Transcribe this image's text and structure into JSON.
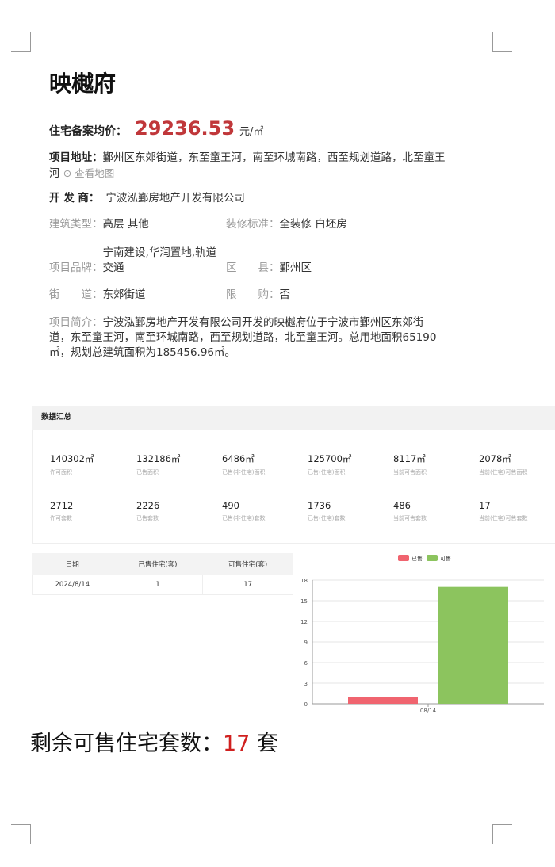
{
  "project": {
    "name": "映樾府",
    "price_label": "住宅备案均价：",
    "price_value": "29236.53",
    "price_unit": "元/㎡",
    "address_label": "项目地址：",
    "address": "鄞州区东郊街道，东至童王河，南至环城南路，西至规划道路，北至童王河",
    "map_link": "⊙ 查看地图",
    "developer_label": "开 发 商：",
    "developer": "宁波泓鄞房地产开发有限公司"
  },
  "info": {
    "building_type_label": "建筑类型：",
    "building_type": "高层 其他",
    "decoration_label": "装修标准：",
    "decoration": "全装修 白坯房",
    "brand_label": "项目品牌：",
    "brand_line1": "宁南建设,华润置地,轨道",
    "brand_line2": "交通",
    "district_label": "区　　县：",
    "district": "鄞州区",
    "street_label": "街　　道：",
    "street": "东郊街道",
    "limit_label": "限　　购：",
    "limit": "否",
    "intro_label": "项目简介：",
    "intro": "宁波泓鄞房地产开发有限公司开发的映樾府位于宁波市鄞州区东郊街道，东至童王河，南至环城南路，西至规划道路，北至童王河。总用地面积65190㎡，规划总建筑面积为185456.96㎡。"
  },
  "summary_panel": {
    "title": "数据汇总",
    "stats": [
      {
        "value": "140302㎡",
        "label": "许可面积"
      },
      {
        "value": "132186㎡",
        "label": "已售面积"
      },
      {
        "value": "6486㎡",
        "label": "已售(非住宅)面积"
      },
      {
        "value": "125700㎡",
        "label": "已售(住宅)面积"
      },
      {
        "value": "8117㎡",
        "label": "当前可售面积"
      },
      {
        "value": "2078㎡",
        "label": "当前(住宅)可售面积"
      },
      {
        "value": "2712",
        "label": "许可套数"
      },
      {
        "value": "2226",
        "label": "已售套数"
      },
      {
        "value": "490",
        "label": "已售(非住宅)套数"
      },
      {
        "value": "1736",
        "label": "已售(住宅)套数"
      },
      {
        "value": "486",
        "label": "当前可售套数"
      },
      {
        "value": "17",
        "label": "当前(住宅)可售套数"
      }
    ]
  },
  "table": {
    "headers": [
      "日期",
      "已售住宅(套)",
      "可售住宅(套)"
    ],
    "rows": [
      [
        "2024/8/14",
        "1",
        "17"
      ]
    ]
  },
  "chart_data": {
    "type": "bar",
    "categories": [
      "08/14"
    ],
    "series": [
      {
        "name": "已售",
        "values": [
          1
        ],
        "color": "#f0646f"
      },
      {
        "name": "可售",
        "values": [
          17
        ],
        "color": "#8cc45e"
      }
    ],
    "ylim": [
      0,
      18
    ],
    "yticks": [
      0,
      3,
      6,
      9,
      12,
      15,
      18
    ],
    "grid": true,
    "legend": "top-center"
  },
  "footer": {
    "prefix": "剩余可售住宅套数：",
    "count": "17",
    "suffix": "套"
  }
}
